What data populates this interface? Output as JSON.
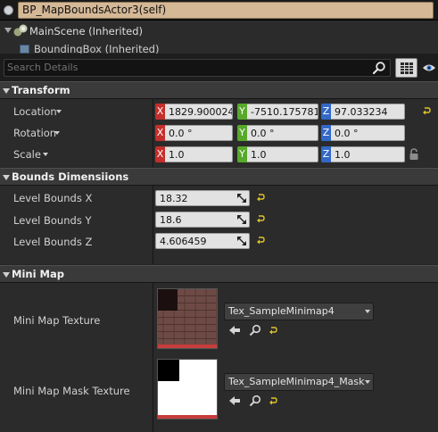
{
  "actor": {
    "title": "BP_MapBoundsActor3(self)"
  },
  "components": [
    {
      "label": "MainScene (Inherited)"
    },
    {
      "label": "BoundingBox (Inherited)"
    }
  ],
  "search": {
    "placeholder": "Search Details"
  },
  "transform": {
    "header": "Transform",
    "rows": [
      {
        "label": "Location",
        "x": "1829.900024",
        "y": "-7510.175781",
        "z": "97.033234"
      },
      {
        "label": "Rotation",
        "x": "0.0 °",
        "y": "0.0 °",
        "z": "0.0 °"
      },
      {
        "label": "Scale",
        "x": "1.0",
        "y": "1.0",
        "z": "1.0"
      }
    ],
    "axis_labels": {
      "x": "X",
      "y": "Y",
      "z": "Z"
    }
  },
  "bounds": {
    "header": "Bounds Dimensiions",
    "rows": [
      {
        "label": "Level Bounds X",
        "value": "18.32"
      },
      {
        "label": "Level Bounds Y",
        "value": "18.6"
      },
      {
        "label": "Level Bounds Z",
        "value": "4.606459"
      }
    ]
  },
  "minimap": {
    "header": "Mini Map",
    "rows": [
      {
        "label": "Mini Map Texture",
        "asset": "Tex_SampleMinimap4"
      },
      {
        "label": "Mini Map Mask Texture",
        "asset": "Tex_SampleMinimap4_Mask"
      }
    ]
  },
  "colors": {
    "header_bg": "#3a3a3a",
    "axis_x": "#c42f2c",
    "axis_y": "#57a92a",
    "axis_z": "#3268c8",
    "reset_arrow": "#e0c329",
    "title_bg": "#d5b896"
  },
  "icons": [
    "actor-bullet-icon",
    "scene-component-icon",
    "box-component-icon",
    "search-icon",
    "property-matrix-icon",
    "eye-icon",
    "reset-to-default-icon",
    "lock-icon",
    "drag-resize-icon",
    "use-selected-icon",
    "browse-icon"
  ]
}
